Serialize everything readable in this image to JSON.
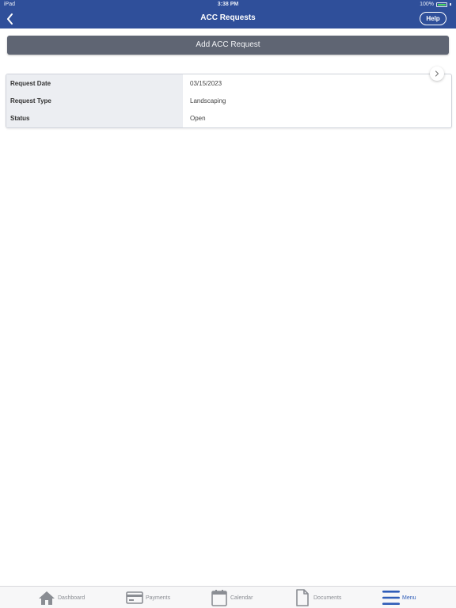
{
  "status_bar": {
    "device": "iPad",
    "time": "3:38 PM",
    "battery": "100%",
    "battery_level": 1.0
  },
  "nav": {
    "title": "ACC Requests",
    "help_label": "Help"
  },
  "actions": {
    "add_label": "Add ACC Request"
  },
  "request": {
    "rows": [
      {
        "label": "Request Date",
        "value": "03/15/2023"
      },
      {
        "label": "Request Type",
        "value": "Landscaping"
      },
      {
        "label": "Status",
        "value": "Open"
      }
    ]
  },
  "tabs": [
    {
      "label": "Dashboard",
      "icon": "home-icon"
    },
    {
      "label": "Payments",
      "icon": "credit-card-icon"
    },
    {
      "label": "Calendar",
      "icon": "calendar-icon"
    },
    {
      "label": "Documents",
      "icon": "document-icon"
    },
    {
      "label": "Menu",
      "icon": "menu-icon",
      "active": true
    }
  ],
  "colors": {
    "header": "#2f4f9a",
    "add_button": "#5f6573",
    "active_tab": "#2f5db8",
    "inactive_tab": "#8a8d93"
  }
}
